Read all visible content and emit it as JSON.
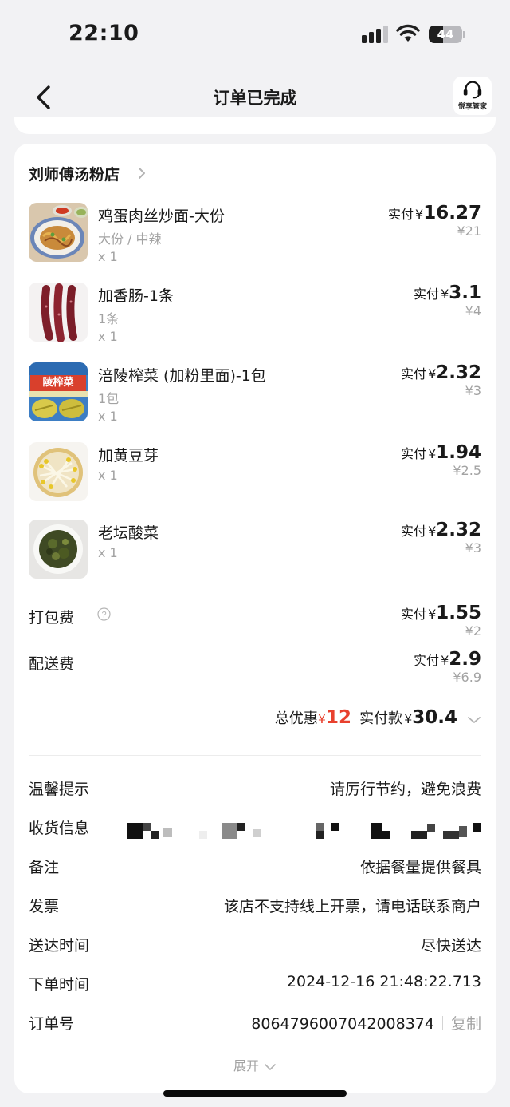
{
  "status_bar": {
    "time": "22:10",
    "battery": "44",
    "battery_level": 0.44
  },
  "nav": {
    "title": "订单已完成",
    "service_label": "悦享管家"
  },
  "shop": {
    "name": "刘师傅汤粉店"
  },
  "items": [
    {
      "name": "鸡蛋肉丝炒面-大份",
      "spec": "大份 / 中辣",
      "qty": "x 1",
      "paid_label": "实付",
      "yen": "¥",
      "paid": "16.27",
      "original": "¥21",
      "thumb_icon": "fried-noodles-image"
    },
    {
      "name": "加香肠-1条",
      "spec": "1条",
      "qty": "x 1",
      "paid_label": "实付",
      "yen": "¥",
      "paid": "3.1",
      "original": "¥4",
      "thumb_icon": "sausage-image"
    },
    {
      "name": "涪陵榨菜 (加粉里面)-1包",
      "spec": "1包",
      "qty": "x 1",
      "paid_label": "实付",
      "yen": "¥",
      "paid": "2.32",
      "original": "¥3",
      "thumb_icon": "pickled-mustard-package-image",
      "thumb_text": "陵榨菜"
    },
    {
      "name": "加黄豆芽",
      "qty": "x 1",
      "paid_label": "实付",
      "yen": "¥",
      "paid": "1.94",
      "original": "¥2.5",
      "thumb_icon": "bean-sprouts-image"
    },
    {
      "name": "老坛酸菜",
      "qty": "x 1",
      "paid_label": "实付",
      "yen": "¥",
      "paid": "2.32",
      "original": "¥3",
      "thumb_icon": "pickled-cabbage-image"
    }
  ],
  "fees": [
    {
      "label": "打包费",
      "paid_label": "实付",
      "yen": "¥",
      "paid": "1.55",
      "original": "¥2",
      "has_help": true
    },
    {
      "label": "配送费",
      "paid_label": "实付",
      "yen": "¥",
      "paid": "2.9",
      "original": "¥6.9"
    }
  ],
  "summary": {
    "discount_label": "总优惠",
    "discount_yen": "¥",
    "discount": "12",
    "total_label": "实付款",
    "total_yen": "¥",
    "total": "30.4"
  },
  "info": {
    "tip_label": "温馨提示",
    "tip_value": "请厉行节约，避免浪费",
    "address_label": "收货信息",
    "note_label": "备注",
    "note_value": "依据餐量提供餐具",
    "invoice_label": "发票",
    "invoice_value": "该店不支持线上开票，请电话联系商户",
    "delivery_label": "送达时间",
    "delivery_value": "尽快送达",
    "order_time_label": "下单时间",
    "order_time_value": "2024-12-16 21:48:22.713",
    "order_no_label": "订单号",
    "order_no_value": "8064796007042008374",
    "copy_label": "复制"
  },
  "expand_label": "展开",
  "colors": {
    "accent_red": "#e8412e",
    "muted": "#a3a3a3",
    "background": "#f2f2f4"
  }
}
